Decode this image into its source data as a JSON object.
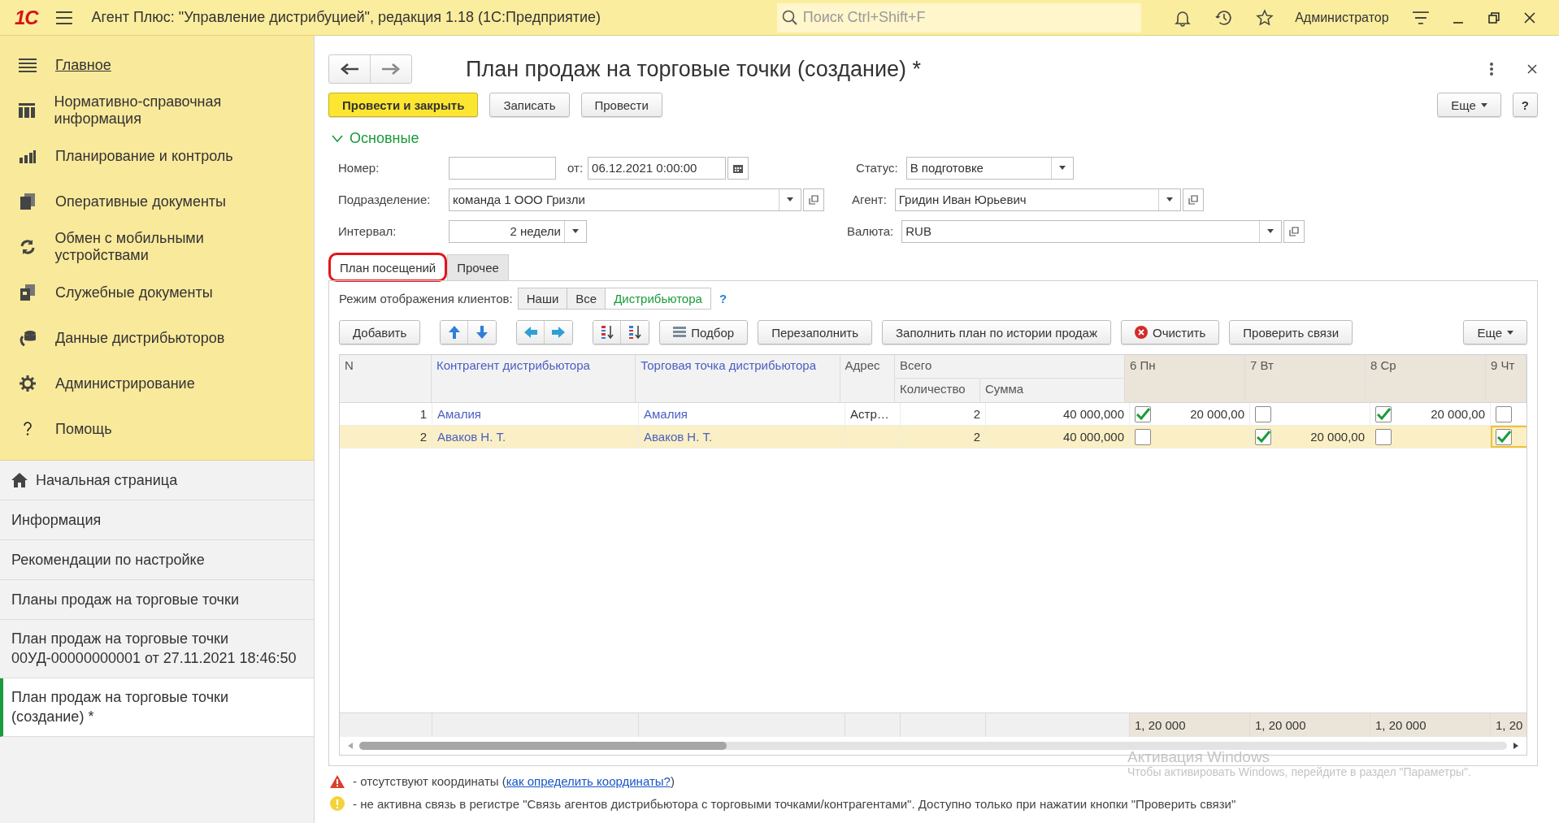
{
  "app": {
    "logo": "1С",
    "title": "Агент Плюс: \"Управление дистрибуцией\", редакция 1.18  (1С:Предприятие)",
    "search": {
      "placeholder": "Поиск Ctrl+Shift+F"
    },
    "user": "Администратор"
  },
  "sidebar": {
    "sections": [
      {
        "label": "Главное",
        "selected": true
      },
      {
        "label": "Нормативно-справочная информация",
        "selected": false
      },
      {
        "label": "Планирование и контроль",
        "selected": false
      },
      {
        "label": "Оперативные документы",
        "selected": false
      },
      {
        "label": "Обмен с мобильными устройствами",
        "selected": false
      },
      {
        "label": "Служебные документы",
        "selected": false
      },
      {
        "label": "Данные дистрибьюторов",
        "selected": false
      },
      {
        "label": "Администрирование",
        "selected": false
      },
      {
        "label": "Помощь",
        "selected": false
      }
    ],
    "open_windows": [
      {
        "label": "Начальная страница",
        "kind": "home",
        "selected": false
      },
      {
        "label": "Информация",
        "kind": "page",
        "selected": false
      },
      {
        "label": "Рекомендации по настройке",
        "kind": "page",
        "selected": false
      },
      {
        "label": "Планы продаж на торговые точки",
        "kind": "page",
        "selected": false
      },
      {
        "label": "План продаж на торговые точки 00УД-00000000001 от 27.11.2021 18:46:50",
        "kind": "page",
        "selected": false
      },
      {
        "label": "План продаж на торговые точки (создание) *",
        "kind": "page",
        "selected": true
      }
    ]
  },
  "form": {
    "title": "План продаж на торговые точки (создание) *",
    "commands": [
      {
        "label": "Провести и закрыть",
        "kind": "primary"
      },
      {
        "label": "Записать",
        "kind": "plain"
      },
      {
        "label": "Провести",
        "kind": "plain"
      }
    ],
    "more": "Еще",
    "help": "?",
    "section": {
      "label": "Основные",
      "expanded": true
    },
    "fields": {
      "number": {
        "label": "Номер:"
      },
      "date": {
        "label": "от:",
        "value": "06.12.2021  0:00:00"
      },
      "status": {
        "label": "Статус:",
        "value": "В подготовке"
      },
      "division": {
        "label": "Подразделение:",
        "value": "команда 1 ООО Гризли"
      },
      "agent": {
        "label": "Агент:",
        "value": "Гридин Иван Юрьевич"
      },
      "interval": {
        "label": "Интервал:",
        "value": "2 недели"
      },
      "currency": {
        "label": "Валюта:",
        "value": "RUB"
      }
    },
    "tabs": [
      {
        "label": "План посещений",
        "selected": true,
        "highlighted": true
      },
      {
        "label": "Прочее",
        "selected": false,
        "highlighted": false
      }
    ],
    "display_mode": {
      "label": "Режим отображения клиентов:",
      "options": [
        {
          "label": "Наши",
          "selected": false
        },
        {
          "label": "Все",
          "selected": false
        },
        {
          "label": "Дистрибьютора",
          "selected": true
        }
      ],
      "help": "?"
    },
    "toolbar": [
      {
        "label": "Добавить",
        "kind": "plain"
      },
      {
        "label": "Подбор",
        "kind": "picker"
      },
      {
        "label": "Перезаполнить",
        "kind": "plain"
      },
      {
        "label": "Заполнить план по истории продаж",
        "kind": "plain"
      },
      {
        "label": "Очистить",
        "kind": "clear"
      },
      {
        "label": "Проверить связи",
        "kind": "plain"
      }
    ],
    "toolbar_more": "Еще",
    "table": {
      "columns": {
        "n": "N",
        "counterparty": "Контрагент дистрибьютора",
        "outlet": "Торговая точка дистрибьютора",
        "address": "Адрес",
        "total": "Всего",
        "quantity": "Количество",
        "sum": "Сумма",
        "days": [
          "6 Пн",
          "7 Вт",
          "8 Ср",
          "9 Чт"
        ]
      },
      "rows": [
        {
          "n": "1",
          "counterparty": "Амалия",
          "outlet": "Амалия",
          "address": "Астр…",
          "quantity": "2",
          "sum": "40 000,000",
          "selected": false,
          "days": [
            {
              "checked": true,
              "amount": "20 000,00"
            },
            {
              "checked": false
            },
            {
              "checked": true,
              "amount": "20 000,00"
            },
            {
              "checked": false
            }
          ]
        },
        {
          "n": "2",
          "counterparty": "Аваков Н. Т.",
          "outlet": "Аваков Н. Т.",
          "quantity": "2",
          "sum": "40 000,000",
          "selected": true,
          "days": [
            {
              "checked": false
            },
            {
              "checked": true,
              "amount": "20 000,00"
            },
            {
              "checked": false
            },
            {
              "checked": true
            }
          ]
        }
      ],
      "totals": [
        "1, 20 000",
        "1, 20 000",
        "1, 20 000",
        "1, 20"
      ]
    },
    "notes": [
      {
        "kind": "warning",
        "text": " - отсутствуют координаты (",
        "link": "как определить координаты?",
        "tail": ")"
      },
      {
        "kind": "attention",
        "text": " -  не активна связь в регистре \"Связь агентов дистрибьютора с торговыми точками/контрагентами\". Доступно только при нажатии кнопки \"Проверить связи\""
      }
    ]
  },
  "os_notice": {
    "title": "Активация Windows",
    "text": "Чтобы активировать Windows, перейдите в раздел \"Параметры\"."
  }
}
